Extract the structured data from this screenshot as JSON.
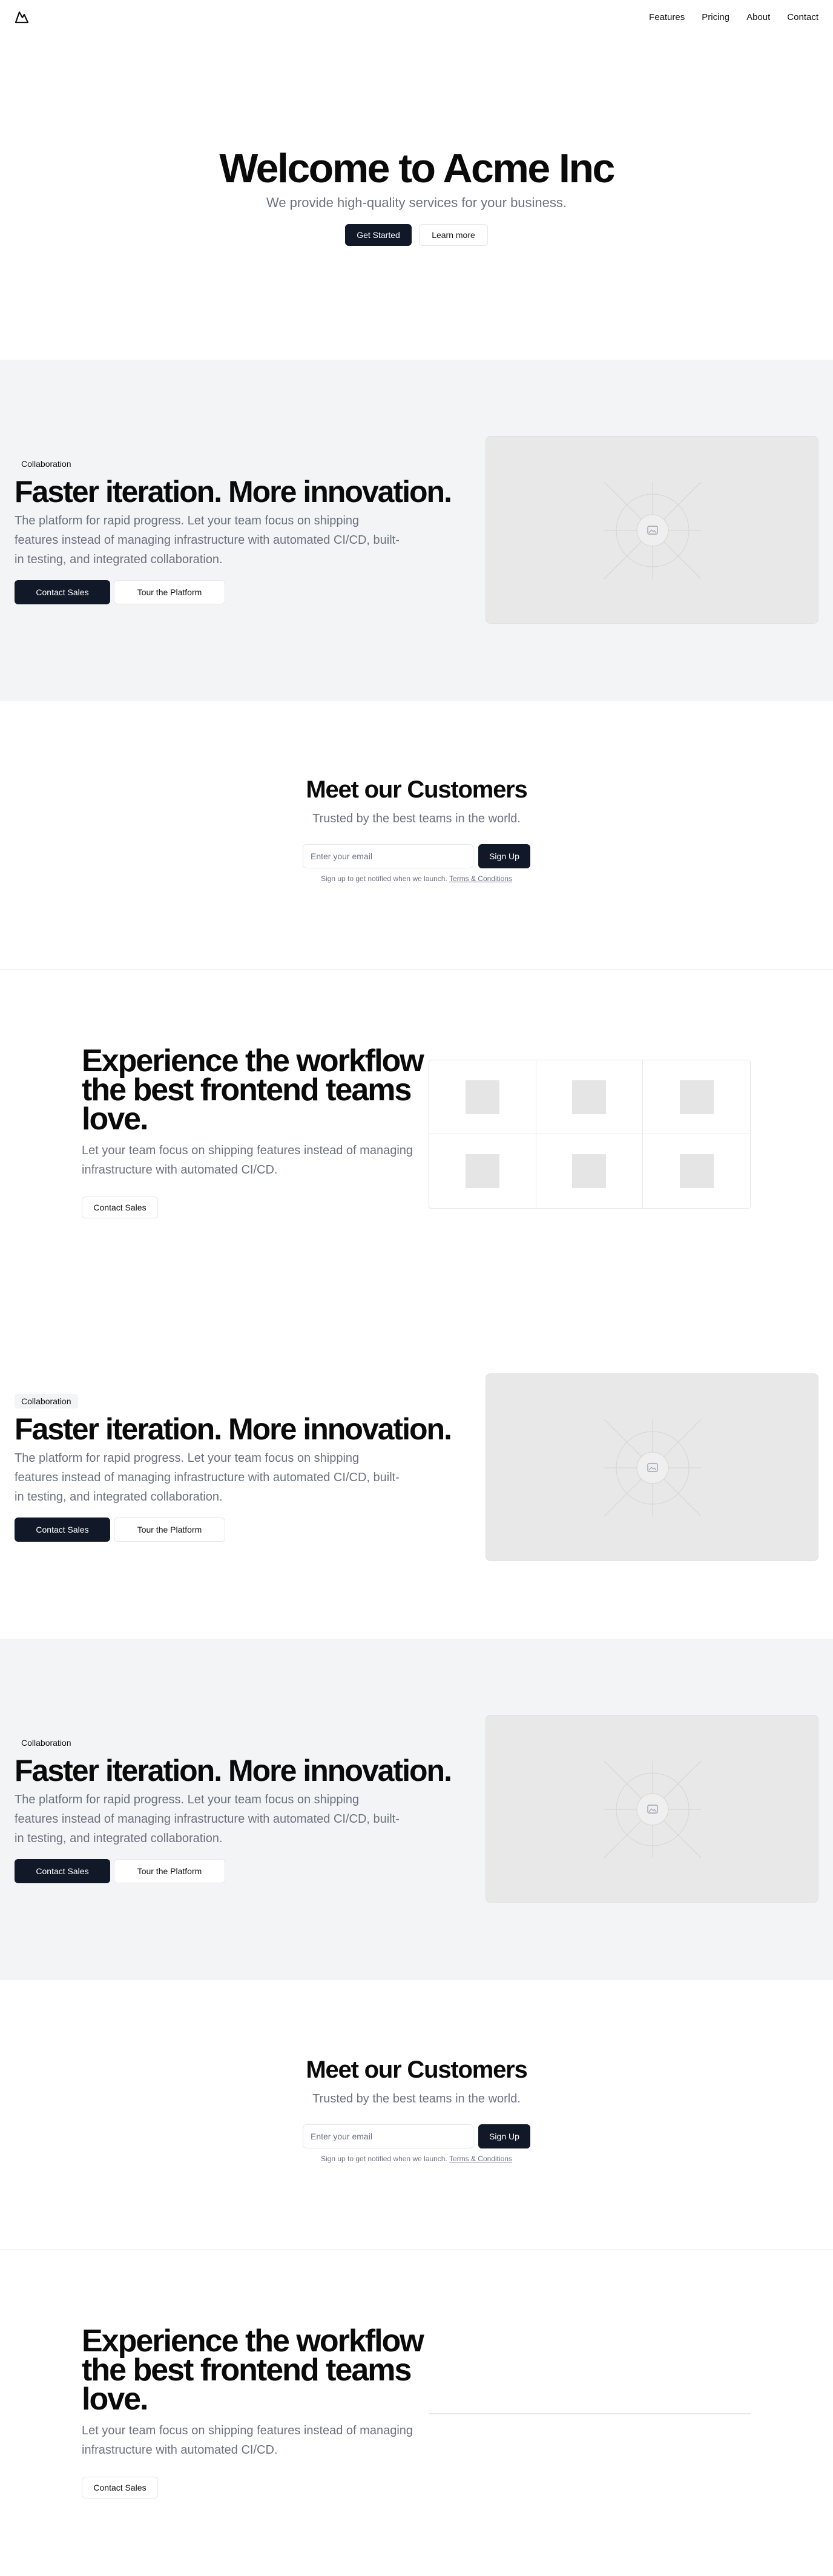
{
  "header": {
    "logo_icon": "mountain-logo-icon",
    "nav": [
      "Features",
      "Pricing",
      "About",
      "Contact"
    ]
  },
  "hero": {
    "title": "Welcome to Acme Inc",
    "subtitle": "We provide high-quality services for your business.",
    "primary": "Get Started",
    "secondary": "Learn more"
  },
  "features": [
    {
      "badge": "Collaboration",
      "title": "Faster iteration. More innovation.",
      "description": "The platform for rapid progress. Let your team focus on shipping features instead of managing infrastructure with automated CI/CD, built-in testing, and integrated collaboration.",
      "primary": "Contact Sales",
      "secondary": "Tour the Platform"
    },
    {
      "badge": "Collaboration",
      "title": "Faster iteration. More innovation.",
      "description": "The platform for rapid progress. Let your team focus on shipping features instead of managing infrastructure with automated CI/CD, built-in testing, and integrated collaboration.",
      "primary": "Contact Sales",
      "secondary": "Tour the Platform"
    },
    {
      "badge": "Collaboration",
      "title": "Faster iteration. More innovation.",
      "description": "The platform for rapid progress. Let your team focus on shipping features instead of managing infrastructure with automated CI/CD, built-in testing, and integrated collaboration.",
      "primary": "Contact Sales",
      "secondary": "Tour the Platform"
    }
  ],
  "customers": [
    {
      "title": "Meet our Customers",
      "subtitle": "Trusted by the best teams in the world.",
      "email_placeholder": "Enter your email",
      "button": "Sign Up",
      "fine_print": "Sign up to get notified when we launch.",
      "terms": "Terms & Conditions"
    },
    {
      "title": "Meet our Customers",
      "subtitle": "Trusted by the best teams in the world.",
      "email_placeholder": "Enter your email",
      "button": "Sign Up",
      "fine_print": "Sign up to get notified when we launch.",
      "terms": "Terms & Conditions"
    }
  ],
  "workflow": [
    {
      "title_lines": [
        "Experience the workflow",
        "the best frontend teams",
        "love."
      ],
      "description": "Let your team focus on shipping features instead of managing infrastructure with automated CI/CD.",
      "button": "Contact Sales"
    },
    {
      "title_lines": [
        "Experience the workflow",
        "the best frontend teams",
        "love."
      ],
      "description": "Let your team focus on shipping features instead of managing infrastructure with automated CI/CD.",
      "button": "Contact Sales"
    }
  ],
  "colors": {
    "dark_button": "#111827",
    "gray_section": "#f3f4f6",
    "muted_text": "#6b7280"
  }
}
